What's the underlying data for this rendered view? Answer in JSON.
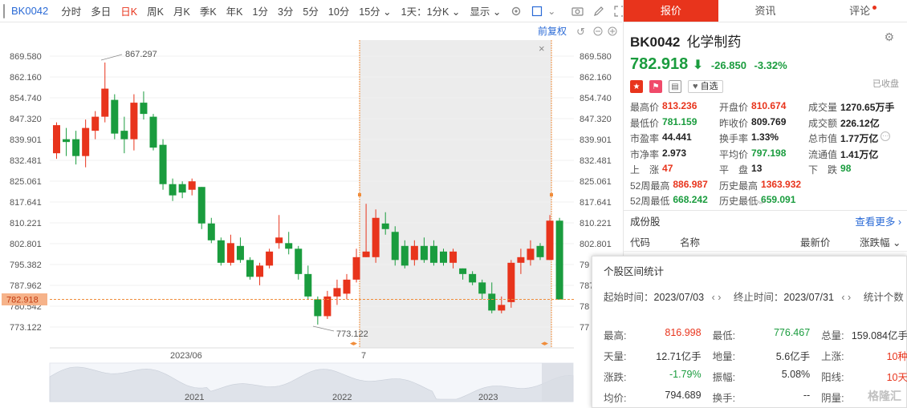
{
  "toolbar": {
    "code": "BK0042",
    "items": [
      "分时",
      "多日",
      "日K",
      "周K",
      "月K",
      "季K",
      "年K",
      "1分",
      "3分",
      "5分",
      "10分",
      "15分 ⌄",
      "1天：1分K ⌄",
      "显示 ⌄"
    ],
    "active_index": 2
  },
  "chart": {
    "restore_label": "前复权",
    "price_label": "782.918",
    "high_label": "867.297",
    "low_label": "773.122",
    "date_labels": [
      "2023/06",
      "7"
    ],
    "nav_years": [
      "2021",
      "2022",
      "2023"
    ],
    "close_x": "×",
    "up_color": "#e8341c",
    "down_color": "#1a9c3e"
  },
  "chart_data": {
    "type": "candlestick",
    "ylim": [
      768.0,
      873.0
    ],
    "yticks": [
      "869.580",
      "862.160",
      "854.740",
      "847.320",
      "839.901",
      "832.481",
      "825.061",
      "817.641",
      "810.221",
      "802.801",
      "795.382",
      "787.962",
      "780.542",
      "773.122"
    ],
    "yticks_right": [
      "869.580",
      "862.160",
      "854.740",
      "847.320",
      "839.901",
      "832.481",
      "825.061",
      "817.641",
      "810.221",
      "802.801",
      "79",
      "787.962",
      "78",
      "77"
    ],
    "candles": [
      {
        "o": 835.0,
        "h": 846.0,
        "l": 833.0,
        "c": 845.0
      },
      {
        "o": 840.0,
        "h": 844.0,
        "l": 834.0,
        "c": 839.0
      },
      {
        "o": 840.0,
        "h": 843.0,
        "l": 831.0,
        "c": 834.0
      },
      {
        "o": 834.0,
        "h": 847.0,
        "l": 830.0,
        "c": 844.0
      },
      {
        "o": 843.0,
        "h": 850.0,
        "l": 840.0,
        "c": 848.0
      },
      {
        "o": 848.0,
        "h": 867.3,
        "l": 846.0,
        "c": 858.0
      },
      {
        "o": 854.0,
        "h": 856.0,
        "l": 840.0,
        "c": 842.0
      },
      {
        "o": 843.0,
        "h": 848.0,
        "l": 835.0,
        "c": 840.0
      },
      {
        "o": 840.0,
        "h": 856.0,
        "l": 836.0,
        "c": 853.0
      },
      {
        "o": 853.0,
        "h": 857.0,
        "l": 847.0,
        "c": 849.0
      },
      {
        "o": 848.0,
        "h": 849.0,
        "l": 836.0,
        "c": 837.0
      },
      {
        "o": 838.0,
        "h": 840.0,
        "l": 822.0,
        "c": 824.0
      },
      {
        "o": 824.0,
        "h": 826.0,
        "l": 818.0,
        "c": 820.0
      },
      {
        "o": 824.0,
        "h": 825.0,
        "l": 819.0,
        "c": 821.0
      },
      {
        "o": 822.0,
        "h": 826.0,
        "l": 820.0,
        "c": 825.0
      },
      {
        "o": 823.0,
        "h": 823.0,
        "l": 808.0,
        "c": 810.0
      },
      {
        "o": 810.0,
        "h": 812.0,
        "l": 803.0,
        "c": 804.0
      },
      {
        "o": 804.0,
        "h": 805.0,
        "l": 795.0,
        "c": 796.0
      },
      {
        "o": 796.0,
        "h": 806.0,
        "l": 795.0,
        "c": 803.0
      },
      {
        "o": 802.0,
        "h": 805.0,
        "l": 796.0,
        "c": 797.0
      },
      {
        "o": 797.0,
        "h": 798.0,
        "l": 790.0,
        "c": 791.0
      },
      {
        "o": 791.0,
        "h": 796.0,
        "l": 788.0,
        "c": 795.0
      },
      {
        "o": 795.0,
        "h": 801.0,
        "l": 794.0,
        "c": 800.0
      },
      {
        "o": 803.0,
        "h": 813.0,
        "l": 801.0,
        "c": 805.0
      },
      {
        "o": 803.0,
        "h": 807.0,
        "l": 799.0,
        "c": 801.0
      },
      {
        "o": 801.0,
        "h": 802.0,
        "l": 790.0,
        "c": 792.0
      },
      {
        "o": 792.0,
        "h": 795.0,
        "l": 783.0,
        "c": 784.0
      },
      {
        "o": 783.0,
        "h": 784.0,
        "l": 774.0,
        "c": 777.0
      },
      {
        "o": 777.0,
        "h": 786.0,
        "l": 776.0,
        "c": 784.0
      },
      {
        "o": 784.0,
        "h": 790.0,
        "l": 781.0,
        "c": 787.0
      },
      {
        "o": 785.0,
        "h": 792.0,
        "l": 783.0,
        "c": 790.0
      },
      {
        "o": 790.0,
        "h": 801.0,
        "l": 789.0,
        "c": 798.0
      },
      {
        "o": 798.0,
        "h": 817.0,
        "l": 798.0,
        "c": 800.0
      },
      {
        "o": 798.0,
        "h": 815.0,
        "l": 796.0,
        "c": 812.0
      },
      {
        "o": 810.0,
        "h": 814.0,
        "l": 806.0,
        "c": 808.0
      },
      {
        "o": 807.0,
        "h": 809.0,
        "l": 795.0,
        "c": 797.0
      },
      {
        "o": 802.0,
        "h": 804.0,
        "l": 794.0,
        "c": 795.0
      },
      {
        "o": 797.0,
        "h": 804.0,
        "l": 795.0,
        "c": 802.0
      },
      {
        "o": 802.0,
        "h": 805.0,
        "l": 796.0,
        "c": 797.0
      },
      {
        "o": 802.0,
        "h": 804.0,
        "l": 795.0,
        "c": 796.0
      },
      {
        "o": 800.0,
        "h": 801.0,
        "l": 795.0,
        "c": 796.0
      },
      {
        "o": 796.0,
        "h": 801.0,
        "l": 794.0,
        "c": 800.0
      },
      {
        "o": 794.0,
        "h": 794.0,
        "l": 790.0,
        "c": 792.0
      },
      {
        "o": 792.0,
        "h": 793.0,
        "l": 788.0,
        "c": 789.0
      },
      {
        "o": 789.0,
        "h": 790.0,
        "l": 783.0,
        "c": 785.0
      },
      {
        "o": 785.0,
        "h": 789.0,
        "l": 778.0,
        "c": 779.0
      },
      {
        "o": 779.0,
        "h": 784.0,
        "l": 778.0,
        "c": 781.0
      },
      {
        "o": 782.0,
        "h": 797.0,
        "l": 780.0,
        "c": 796.0
      },
      {
        "o": 796.0,
        "h": 801.0,
        "l": 792.0,
        "c": 798.0
      },
      {
        "o": 797.0,
        "h": 804.0,
        "l": 795.0,
        "c": 801.0
      },
      {
        "o": 802.0,
        "h": 803.0,
        "l": 797.0,
        "c": 798.0
      },
      {
        "o": 797.0,
        "h": 813.0,
        "l": 797.0,
        "c": 811.0
      },
      {
        "o": 811.0,
        "h": 812.0,
        "l": 782.9,
        "c": 782.9
      }
    ]
  },
  "panel": {
    "tabs": [
      "报价",
      "资讯",
      "评论"
    ],
    "code": "BK0042",
    "name": "化学制药",
    "price": "782.918",
    "arrow": "⬇",
    "change": "-26.850",
    "pct": "-3.32%",
    "collected": "已收盘",
    "fav_label": "自选",
    "stats": [
      [
        {
          "l": "最高价",
          "v": "813.236",
          "c": "red"
        },
        {
          "l": "开盘价",
          "v": "810.674",
          "c": "red"
        },
        {
          "l": "成交量",
          "v": "1270.65万手",
          "c": ""
        }
      ],
      [
        {
          "l": "最低价",
          "v": "781.159",
          "c": "green"
        },
        {
          "l": "昨收价",
          "v": "809.769",
          "c": ""
        },
        {
          "l": "成交额",
          "v": "226.12亿",
          "c": ""
        }
      ],
      [
        {
          "l": "市盈率",
          "v": "44.441",
          "c": ""
        },
        {
          "l": "换手率",
          "v": "1.33%",
          "c": ""
        },
        {
          "l": "总市值",
          "v": "1.77万亿",
          "c": ""
        }
      ],
      [
        {
          "l": "市净率",
          "v": "2.973",
          "c": ""
        },
        {
          "l": "平均价",
          "v": "797.198",
          "c": "green"
        },
        {
          "l": "流通值",
          "v": "1.41万亿",
          "c": ""
        }
      ],
      [
        {
          "l": "上　涨",
          "v": "47",
          "c": "red"
        },
        {
          "l": "平　盘",
          "v": "13",
          "c": ""
        },
        {
          "l": "下　跌",
          "v": "98",
          "c": "green"
        }
      ],
      [
        {
          "l": "52周最高",
          "v": "886.987",
          "c": "red"
        },
        {
          "l": "历史最高",
          "v": "1363.932",
          "c": "red"
        },
        {
          "l": "",
          "v": "",
          "c": ""
        }
      ],
      [
        {
          "l": "52周最低",
          "v": "668.242",
          "c": "green"
        },
        {
          "l": "历史最低",
          "v": "659.091",
          "c": "green"
        },
        {
          "l": "",
          "v": "",
          "c": ""
        }
      ]
    ],
    "constituents_title": "成份股",
    "see_more": "查看更多",
    "cols": [
      "代码",
      "名称",
      "最新价",
      "涨跌幅 ⌄"
    ]
  },
  "popup": {
    "title": "个股区间统计",
    "start_label": "起始时间：",
    "start_value": "2023/07/03",
    "end_label": "终止时间：",
    "end_value": "2023/07/31",
    "count_label": "统计个数",
    "rows": [
      [
        {
          "l": "最高:",
          "v": "816.998",
          "c": "red"
        },
        {
          "l": "最低:",
          "v": "776.467",
          "c": "green"
        },
        {
          "l": "总量:",
          "v": "159.084亿手",
          "c": ""
        }
      ],
      [
        {
          "l": "天量:",
          "v": "12.71亿手",
          "c": ""
        },
        {
          "l": "地量:",
          "v": "5.6亿手",
          "c": ""
        },
        {
          "l": "上涨:",
          "v": "10种",
          "c": "red"
        }
      ],
      [
        {
          "l": "涨跌:",
          "v": "-1.79%",
          "c": "green"
        },
        {
          "l": "振幅:",
          "v": "5.08%",
          "c": ""
        },
        {
          "l": "阳线:",
          "v": "10天",
          "c": "red"
        }
      ],
      [
        {
          "l": "均价:",
          "v": "794.689",
          "c": ""
        },
        {
          "l": "换手:",
          "v": "--",
          "c": ""
        },
        {
          "l": "阴量:",
          "v": "",
          "c": ""
        }
      ]
    ],
    "watermark": "格隆汇"
  }
}
